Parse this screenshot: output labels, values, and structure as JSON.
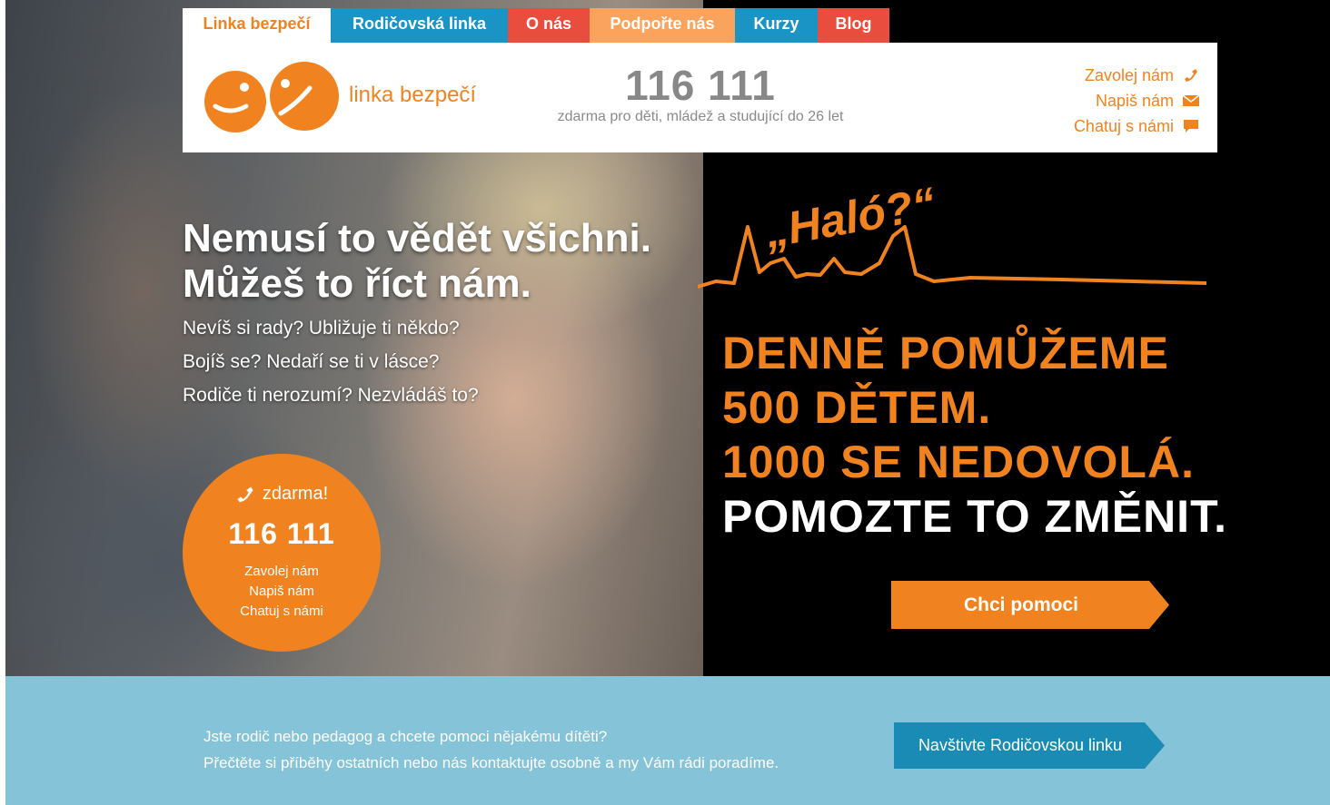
{
  "nav": {
    "tabs": [
      {
        "label": "Linka bezpečí"
      },
      {
        "label": "Rodičovská linka"
      },
      {
        "label": "O nás"
      },
      {
        "label": "Podpořte nás"
      },
      {
        "label": "Kurzy"
      },
      {
        "label": "Blog"
      }
    ]
  },
  "header": {
    "logo_text": "linka bezpečí",
    "phone": "116 111",
    "phone_sub": "zdarma pro děti, mládež a studující do 26 let",
    "contacts": [
      {
        "label": "Zavolej nám",
        "icon": "phone-icon"
      },
      {
        "label": "Napiš nám",
        "icon": "envelope-icon"
      },
      {
        "label": "Chatuj s námi",
        "icon": "chat-icon"
      }
    ]
  },
  "hero": {
    "headline_1": "Nemusí to vědět všichni.",
    "headline_2": "Můžeš to říct nám.",
    "lines": [
      "Nevíš si rady? Ubližuje ti někdo?",
      "Bojíš se? Nedaří se ti v lásce?",
      "Rodiče ti nerozumí? Nezvládáš to?"
    ],
    "circle": {
      "free": "zdarma!",
      "number": "116 111",
      "links": [
        "Zavolej nám",
        "Napiš nám",
        "Chatuj s námi"
      ]
    }
  },
  "ad": {
    "halo": "„Haló?“",
    "line1": "DENNĚ POMŮŽEME",
    "line2": "500 DĚTEM.",
    "line3": "1000 SE NEDOVOLÁ.",
    "line4": "POMOZTE TO ZMĚNIT.",
    "cta": "Chci pomoci"
  },
  "band": {
    "line1": "Jste rodič nebo pedagog a chcete pomoci nějakému dítěti?",
    "line2": "Přečtěte si příběhy ostatních nebo nás kontaktujte osobně a my Vám rádi poradíme.",
    "button": "Navštivte Rodičovskou linku"
  },
  "colors": {
    "orange": "#f0831f",
    "blue": "#1a94c4",
    "red": "#e84d3d",
    "light_orange": "#f9a35c",
    "band": "#85c3d8",
    "band_button": "#1a8bb4"
  }
}
